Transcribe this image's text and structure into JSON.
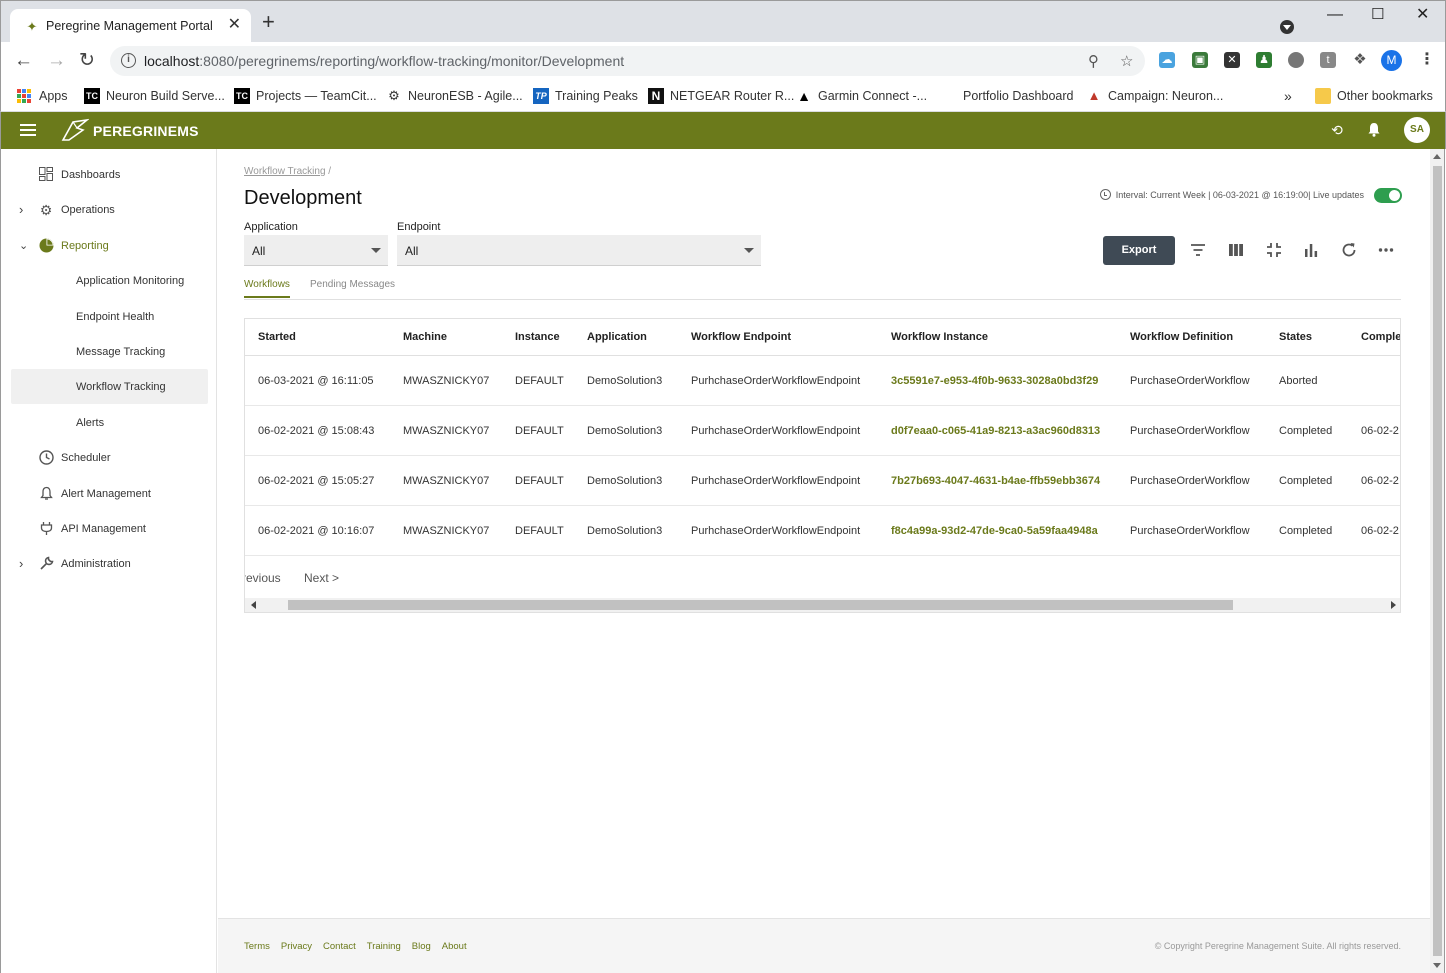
{
  "browser": {
    "tab_title": "Peregrine Management Portal",
    "url_host": "localhost",
    "url_rest": ":8080/peregrinems/reporting/workflow-tracking/monitor/Development",
    "profile_initial": "M",
    "bookmarks": [
      {
        "label": "Apps",
        "icon": "apps-grid-icon"
      },
      {
        "label": "Neuron Build Serve...",
        "icon": "teamcity-icon"
      },
      {
        "label": "Projects — TeamCit...",
        "icon": "teamcity-icon"
      },
      {
        "label": "NeuronESB - Agile...",
        "icon": "agile-icon"
      },
      {
        "label": "Training Peaks",
        "icon": "trainingpeaks-icon"
      },
      {
        "label": "NETGEAR Router R...",
        "icon": "netgear-icon"
      },
      {
        "label": "Garmin Connect -...",
        "icon": "garmin-icon"
      },
      {
        "label": "Portfolio Dashboard",
        "icon": ""
      },
      {
        "label": "Campaign: Neuron...",
        "icon": "dynamics-icon"
      }
    ],
    "more_bookmarks": "»",
    "other_bookmarks": "Other bookmarks"
  },
  "app": {
    "brand": "PEREGRINEMS",
    "user_initials": "SA",
    "colors": {
      "brand": "#6b7a1b",
      "export": "#3f4a55",
      "toggle": "#2e9e4f"
    }
  },
  "sidebar": {
    "items": [
      {
        "label": "Dashboards",
        "icon": "dashboard-icon"
      },
      {
        "label": "Operations",
        "icon": "gear-icon"
      },
      {
        "label": "Reporting",
        "icon": "pie-chart-icon"
      },
      {
        "label": "Application Monitoring"
      },
      {
        "label": "Endpoint Health"
      },
      {
        "label": "Message Tracking"
      },
      {
        "label": "Workflow Tracking"
      },
      {
        "label": "Alerts"
      },
      {
        "label": "Scheduler",
        "icon": "clock-icon"
      },
      {
        "label": "Alert Management",
        "icon": "bell-icon"
      },
      {
        "label": "API Management",
        "icon": "plug-icon"
      },
      {
        "label": "Administration",
        "icon": "wrench-icon"
      }
    ]
  },
  "page": {
    "breadcrumb_link": "Workflow Tracking",
    "breadcrumb_sep": "/",
    "title": "Development",
    "interval": "Interval: Current Week | 06-03-2021 @ 16:19:00| Live updates",
    "live_updates": true,
    "application_label": "Application",
    "application_value": "All",
    "endpoint_label": "Endpoint",
    "endpoint_value": "All",
    "export_label": "Export",
    "tabs": [
      "Workflows",
      "Pending Messages"
    ],
    "active_tab": "Workflows"
  },
  "grid": {
    "columns": [
      "Started",
      "Machine",
      "Instance",
      "Application",
      "Workflow Endpoint",
      "Workflow Instance",
      "Workflow Definition",
      "States",
      "Comple"
    ],
    "rows": [
      [
        "06-03-2021 @ 16:11:05",
        "MWASZNICKY07",
        "DEFAULT",
        "DemoSolution3",
        "PurhchaseOrderWorkflowEndpoint",
        "3c5591e7-e953-4f0b-9633-3028a0bd3f29",
        "PurchaseOrderWorkflow",
        "Aborted",
        ""
      ],
      [
        "06-02-2021 @ 15:08:43",
        "MWASZNICKY07",
        "DEFAULT",
        "DemoSolution3",
        "PurhchaseOrderWorkflowEndpoint",
        "d0f7eaa0-c065-41a9-8213-a3ac960d8313",
        "PurchaseOrderWorkflow",
        "Completed",
        "06-02-2"
      ],
      [
        "06-02-2021 @ 15:05:27",
        "MWASZNICKY07",
        "DEFAULT",
        "DemoSolution3",
        "PurhchaseOrderWorkflowEndpoint",
        "7b27b693-4047-4631-b4ae-ffb59ebb3674",
        "PurchaseOrderWorkflow",
        "Completed",
        "06-02-2"
      ],
      [
        "06-02-2021 @ 10:16:07",
        "MWASZNICKY07",
        "DEFAULT",
        "DemoSolution3",
        "PurhchaseOrderWorkflowEndpoint",
        "f8c4a99a-93d2-47de-9ca0-5a59faa4948a",
        "PurchaseOrderWorkflow",
        "Completed",
        "06-02-2"
      ]
    ],
    "prev_label": "revious",
    "next_label": "Next >"
  },
  "footer": {
    "links": [
      "Terms",
      "Privacy",
      "Contact",
      "Training",
      "Blog",
      "About"
    ],
    "copyright": "© Copyright Peregrine Management Suite. All rights reserved."
  }
}
